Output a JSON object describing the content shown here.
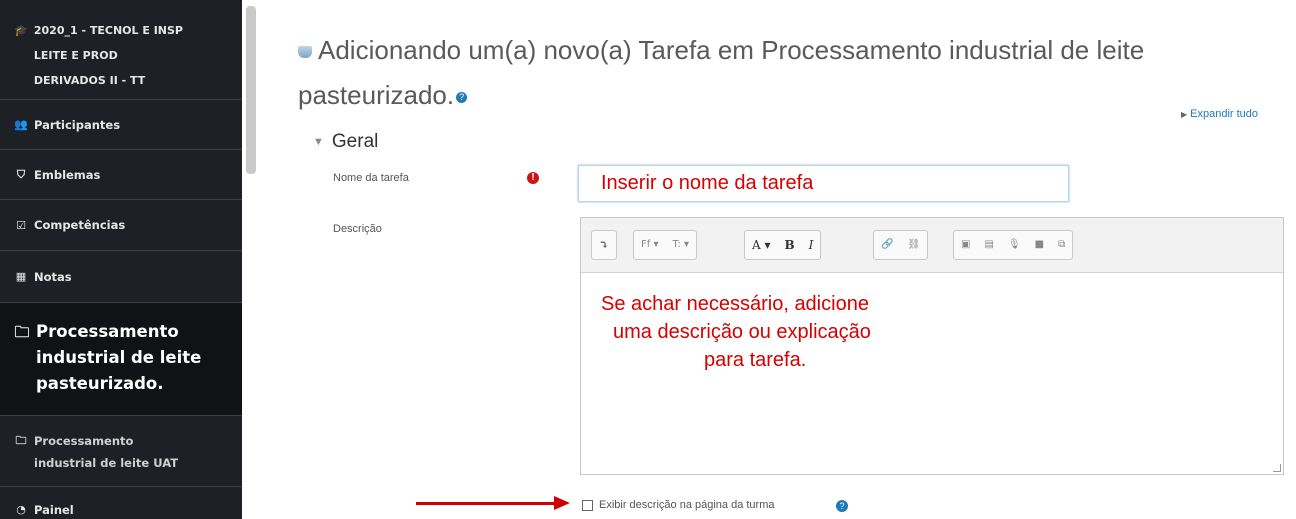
{
  "sidebar": {
    "course": {
      "icon": "graduation-cap-icon",
      "lines": [
        "2020_1 - TECNOL E INSP",
        "LEITE E PROD",
        "DERIVADOS II - TT"
      ]
    },
    "participantes": {
      "icon": "users-icon",
      "label": "Participantes"
    },
    "emblemas": {
      "icon": "shield-icon",
      "label": "Emblemas"
    },
    "competencias": {
      "icon": "checklist-icon",
      "label": "Competências"
    },
    "notas": {
      "icon": "grid-icon",
      "label": "Notas"
    },
    "active": {
      "icon": "folder-icon",
      "lines": [
        "Processamento",
        "industrial de leite",
        "pasteurizado."
      ]
    },
    "uat": {
      "icon": "folder-icon",
      "lines": [
        "Processamento",
        "industrial de leite UAT"
      ]
    },
    "painel": {
      "icon": "dashboard-icon",
      "label": "Painel"
    }
  },
  "page": {
    "title_line1": "Adicionando um(a) novo(a) Tarefa em Processamento industrial de leite",
    "title_line2": "pasteurizado.",
    "expandir": "Expandir tudo",
    "section": "Geral"
  },
  "form": {
    "nome_label": "Nome da tarefa",
    "nome_value": "Inserir o nome da tarefa",
    "desc_label": "Descrição",
    "desc_text": [
      "Se achar necessário, adicione",
      "uma descrição ou explicação",
      "para tarefa."
    ],
    "checkbox_label": "Exibir descrição na página da turma",
    "checkbox_checked": false
  },
  "toolbar": {
    "collapse": "⤵",
    "font": "Ff ▾",
    "paragraph": "T: ▾",
    "color": "A ▾",
    "bold": "B",
    "italic": "I",
    "link": "🔗",
    "unlink": "⛓",
    "image": "▣",
    "media": "▤",
    "audio": "🎙",
    "video": "■",
    "manage": "⧉"
  },
  "colors": {
    "sidebar_bg": "#1d2125",
    "annotation_red": "#d60000",
    "link_blue": "#1f7ab5"
  }
}
